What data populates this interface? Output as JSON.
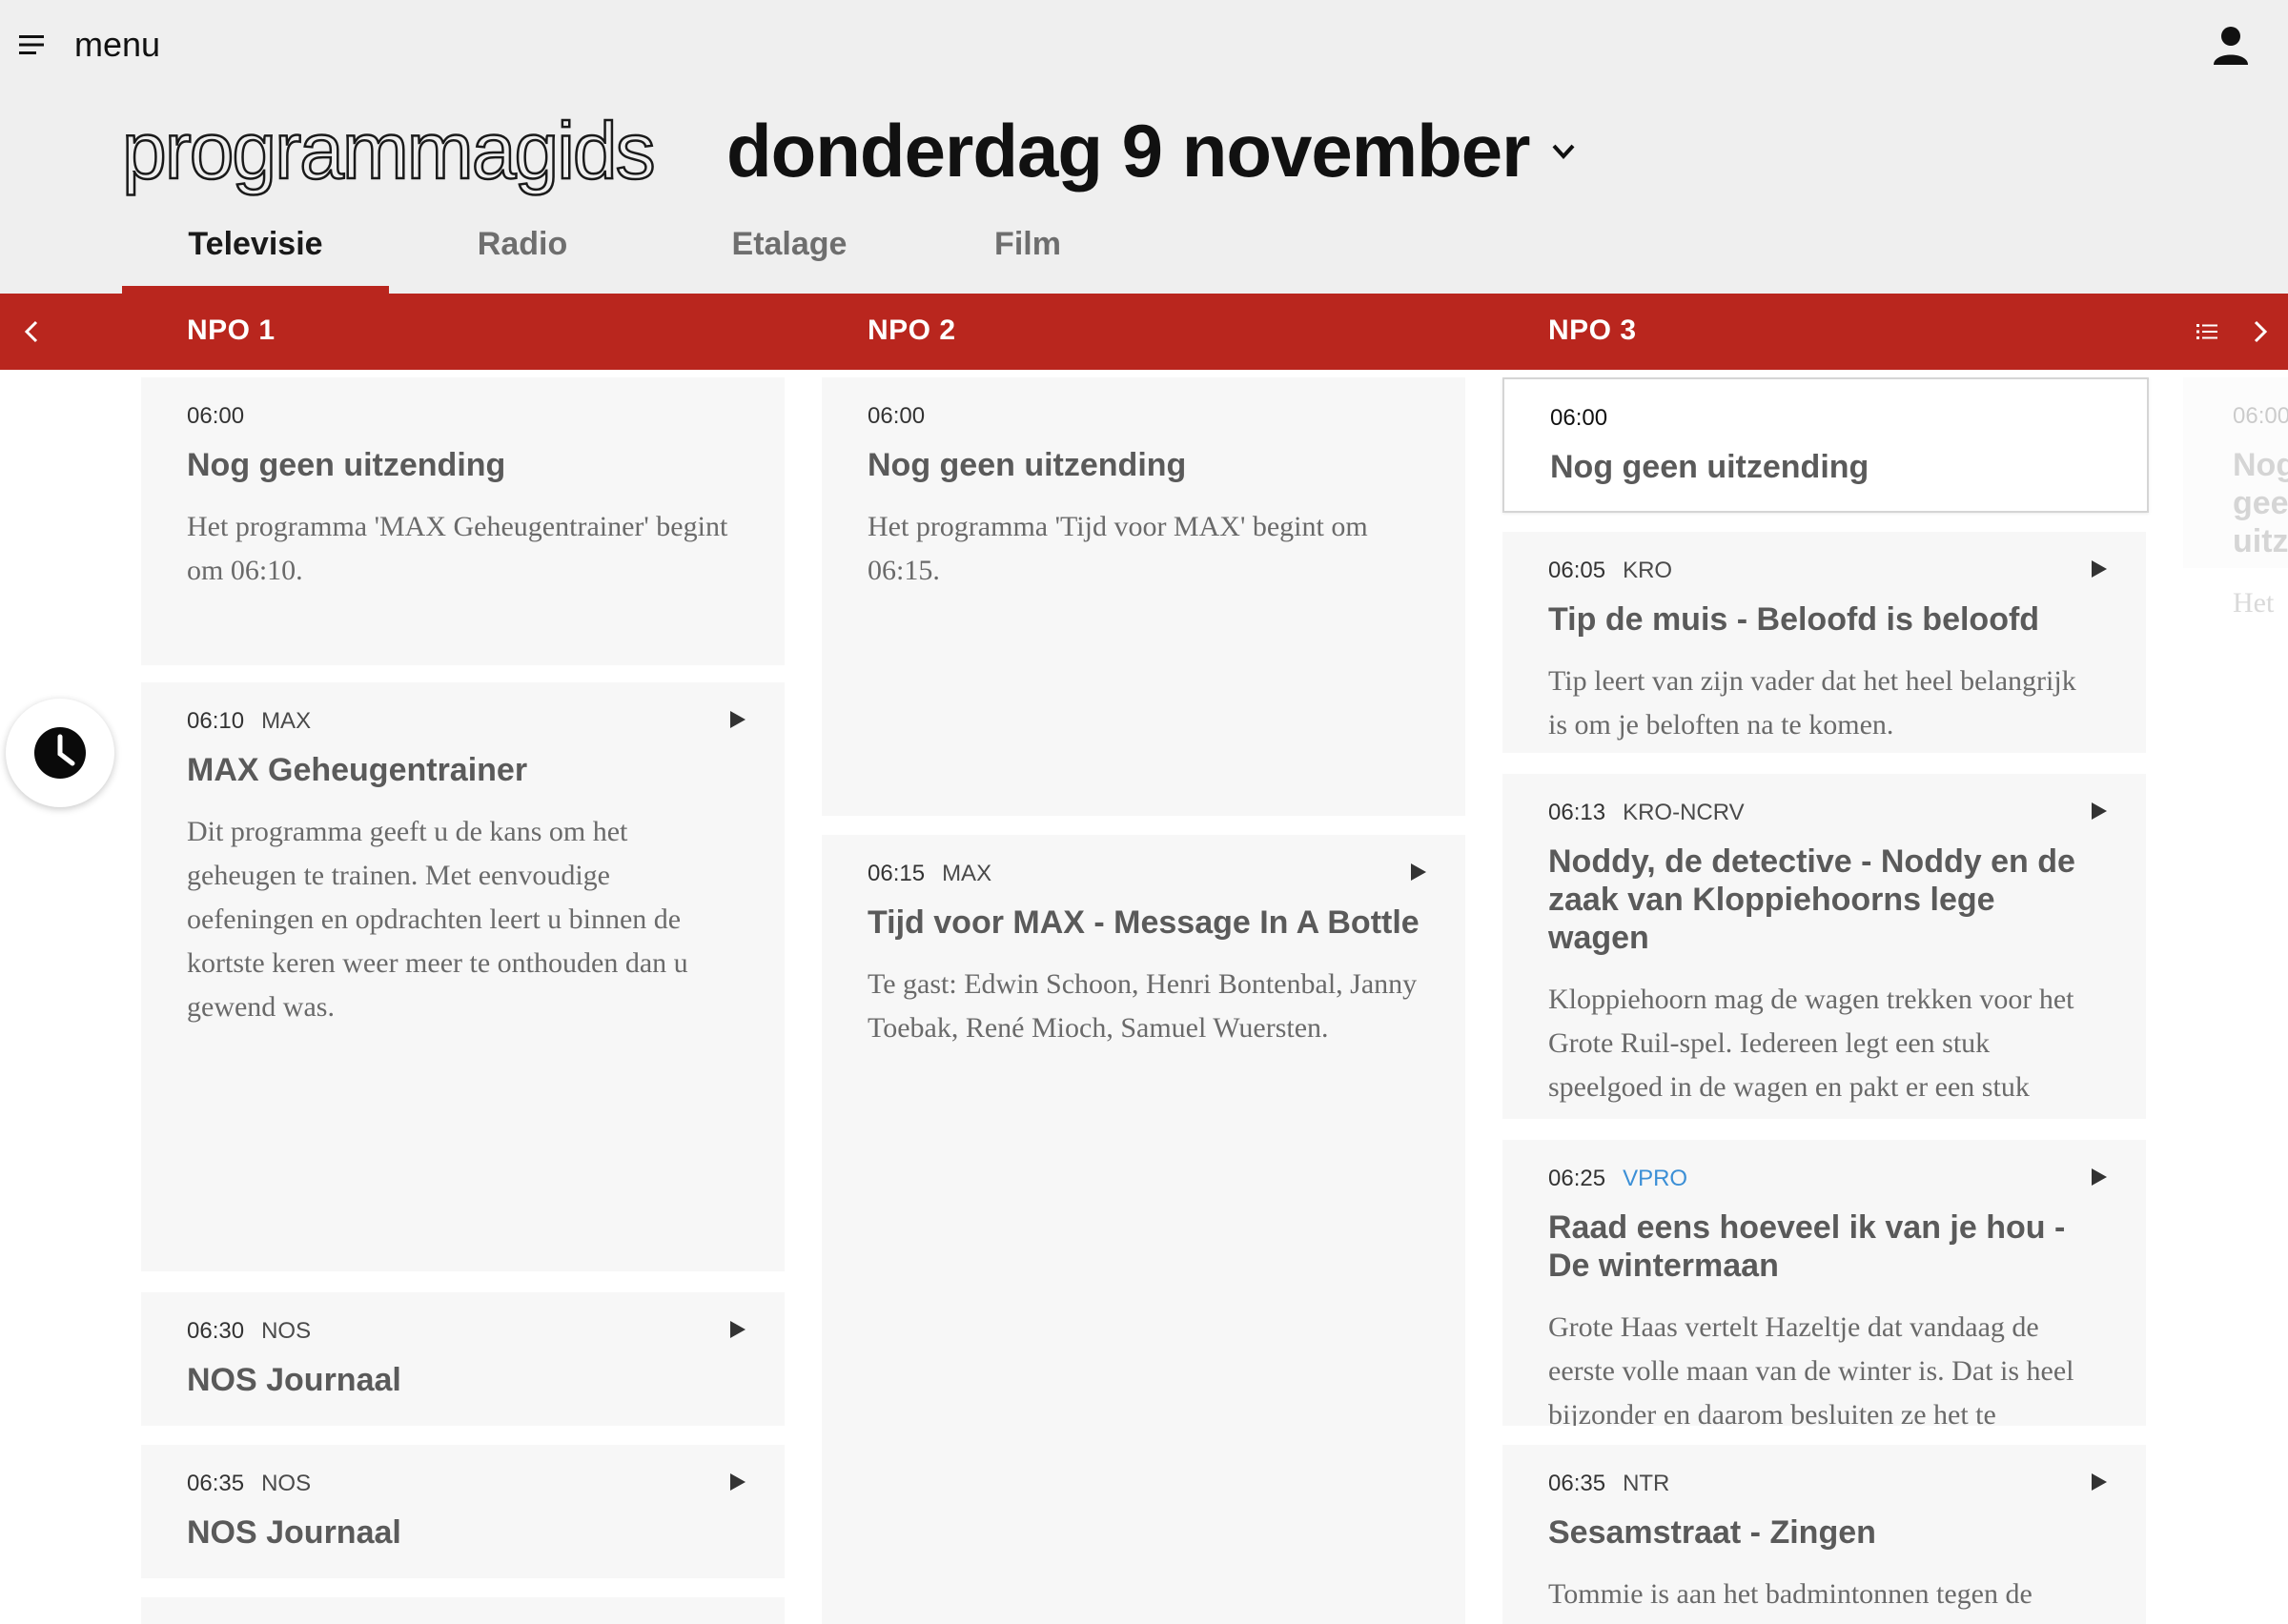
{
  "header": {
    "menu_label": "menu",
    "menu_icon": "hamburger-icon",
    "user_icon": "user-icon",
    "brand": "programmagids",
    "date": "donderdag 9 november",
    "date_icon": "chevron-down-icon"
  },
  "tabs": [
    {
      "label": "Televisie",
      "active": true
    },
    {
      "label": "Radio",
      "active": false
    },
    {
      "label": "Etalage",
      "active": false
    },
    {
      "label": "Film",
      "active": false
    }
  ],
  "channels": [
    "NPO 1",
    "NPO 2",
    "NPO 3"
  ],
  "channel_bar_icons": {
    "prev": "chevron-left-icon",
    "list": "list-icon",
    "next": "chevron-right-icon"
  },
  "accent_color": "#b9261e",
  "schedule": {
    "npo1": [
      {
        "time": "06:00",
        "broadcaster": "",
        "title": "Nog geen uitzending",
        "description": "Het programma 'MAX Geheugentrainer' begint om 06:10."
      },
      {
        "time": "06:10",
        "broadcaster": "MAX",
        "title": "MAX Geheugentrainer",
        "description": "Dit programma geeft u de kans om het geheugen te trainen. Met eenvoudige oefeningen en opdrachten leert u binnen de kortste keren weer meer te onthouden dan u gewend was."
      },
      {
        "time": "06:30",
        "broadcaster": "NOS",
        "title": "NOS Journaal",
        "description": ""
      },
      {
        "time": "06:35",
        "broadcaster": "NOS",
        "title": "NOS Journaal",
        "description": ""
      }
    ],
    "npo2": [
      {
        "time": "06:00",
        "broadcaster": "",
        "title": "Nog geen uitzending",
        "description": "Het programma 'Tijd voor MAX' begint om 06:15."
      },
      {
        "time": "06:15",
        "broadcaster": "MAX",
        "title": "Tijd voor MAX - Message In A Bottle",
        "description": "Te gast: Edwin Schoon, Henri Bontenbal, Janny Toebak, René Mioch, Samuel Wuersten."
      }
    ],
    "npo3": [
      {
        "time": "06:00",
        "broadcaster": "",
        "title": "Nog geen uitzending",
        "description": ""
      },
      {
        "time": "06:05",
        "broadcaster": "KRO",
        "title": "Tip de muis - Beloofd is beloofd",
        "description": "Tip leert van zijn vader dat het heel belangrijk is om je beloften na te komen."
      },
      {
        "time": "06:13",
        "broadcaster": "KRO-NCRV",
        "title": "Noddy, de detective - Noddy en de zaak van Kloppiehoorns lege wagen",
        "description": "Kloppiehoorn mag de wagen trekken voor het Grote Ruil-spel. Iedereen legt een stuk speelgoed in de wagen en pakt er een stuk speelgoed uit. Het is heel leuk, tot de jojo van"
      },
      {
        "time": "06:25",
        "broadcaster": "VPRO",
        "title": "Raad eens hoeveel ik van je hou - De wintermaan",
        "description": "Grote Haas vertelt Hazeltje dat vandaag de eerste volle maan van de winter is. Dat is heel bijzonder en daarom besluiten ze het te"
      },
      {
        "time": "06:35",
        "broadcaster": "NTR",
        "title": "Sesamstraat - Zingen",
        "description": "Tommie is aan het badmintonnen tegen de"
      }
    ],
    "next_channel_peek": {
      "time": "06:00",
      "title": "Nog geen uitzending",
      "description": "Het programma"
    }
  },
  "clock_icon": "clock-icon",
  "play_icon": "play-icon"
}
